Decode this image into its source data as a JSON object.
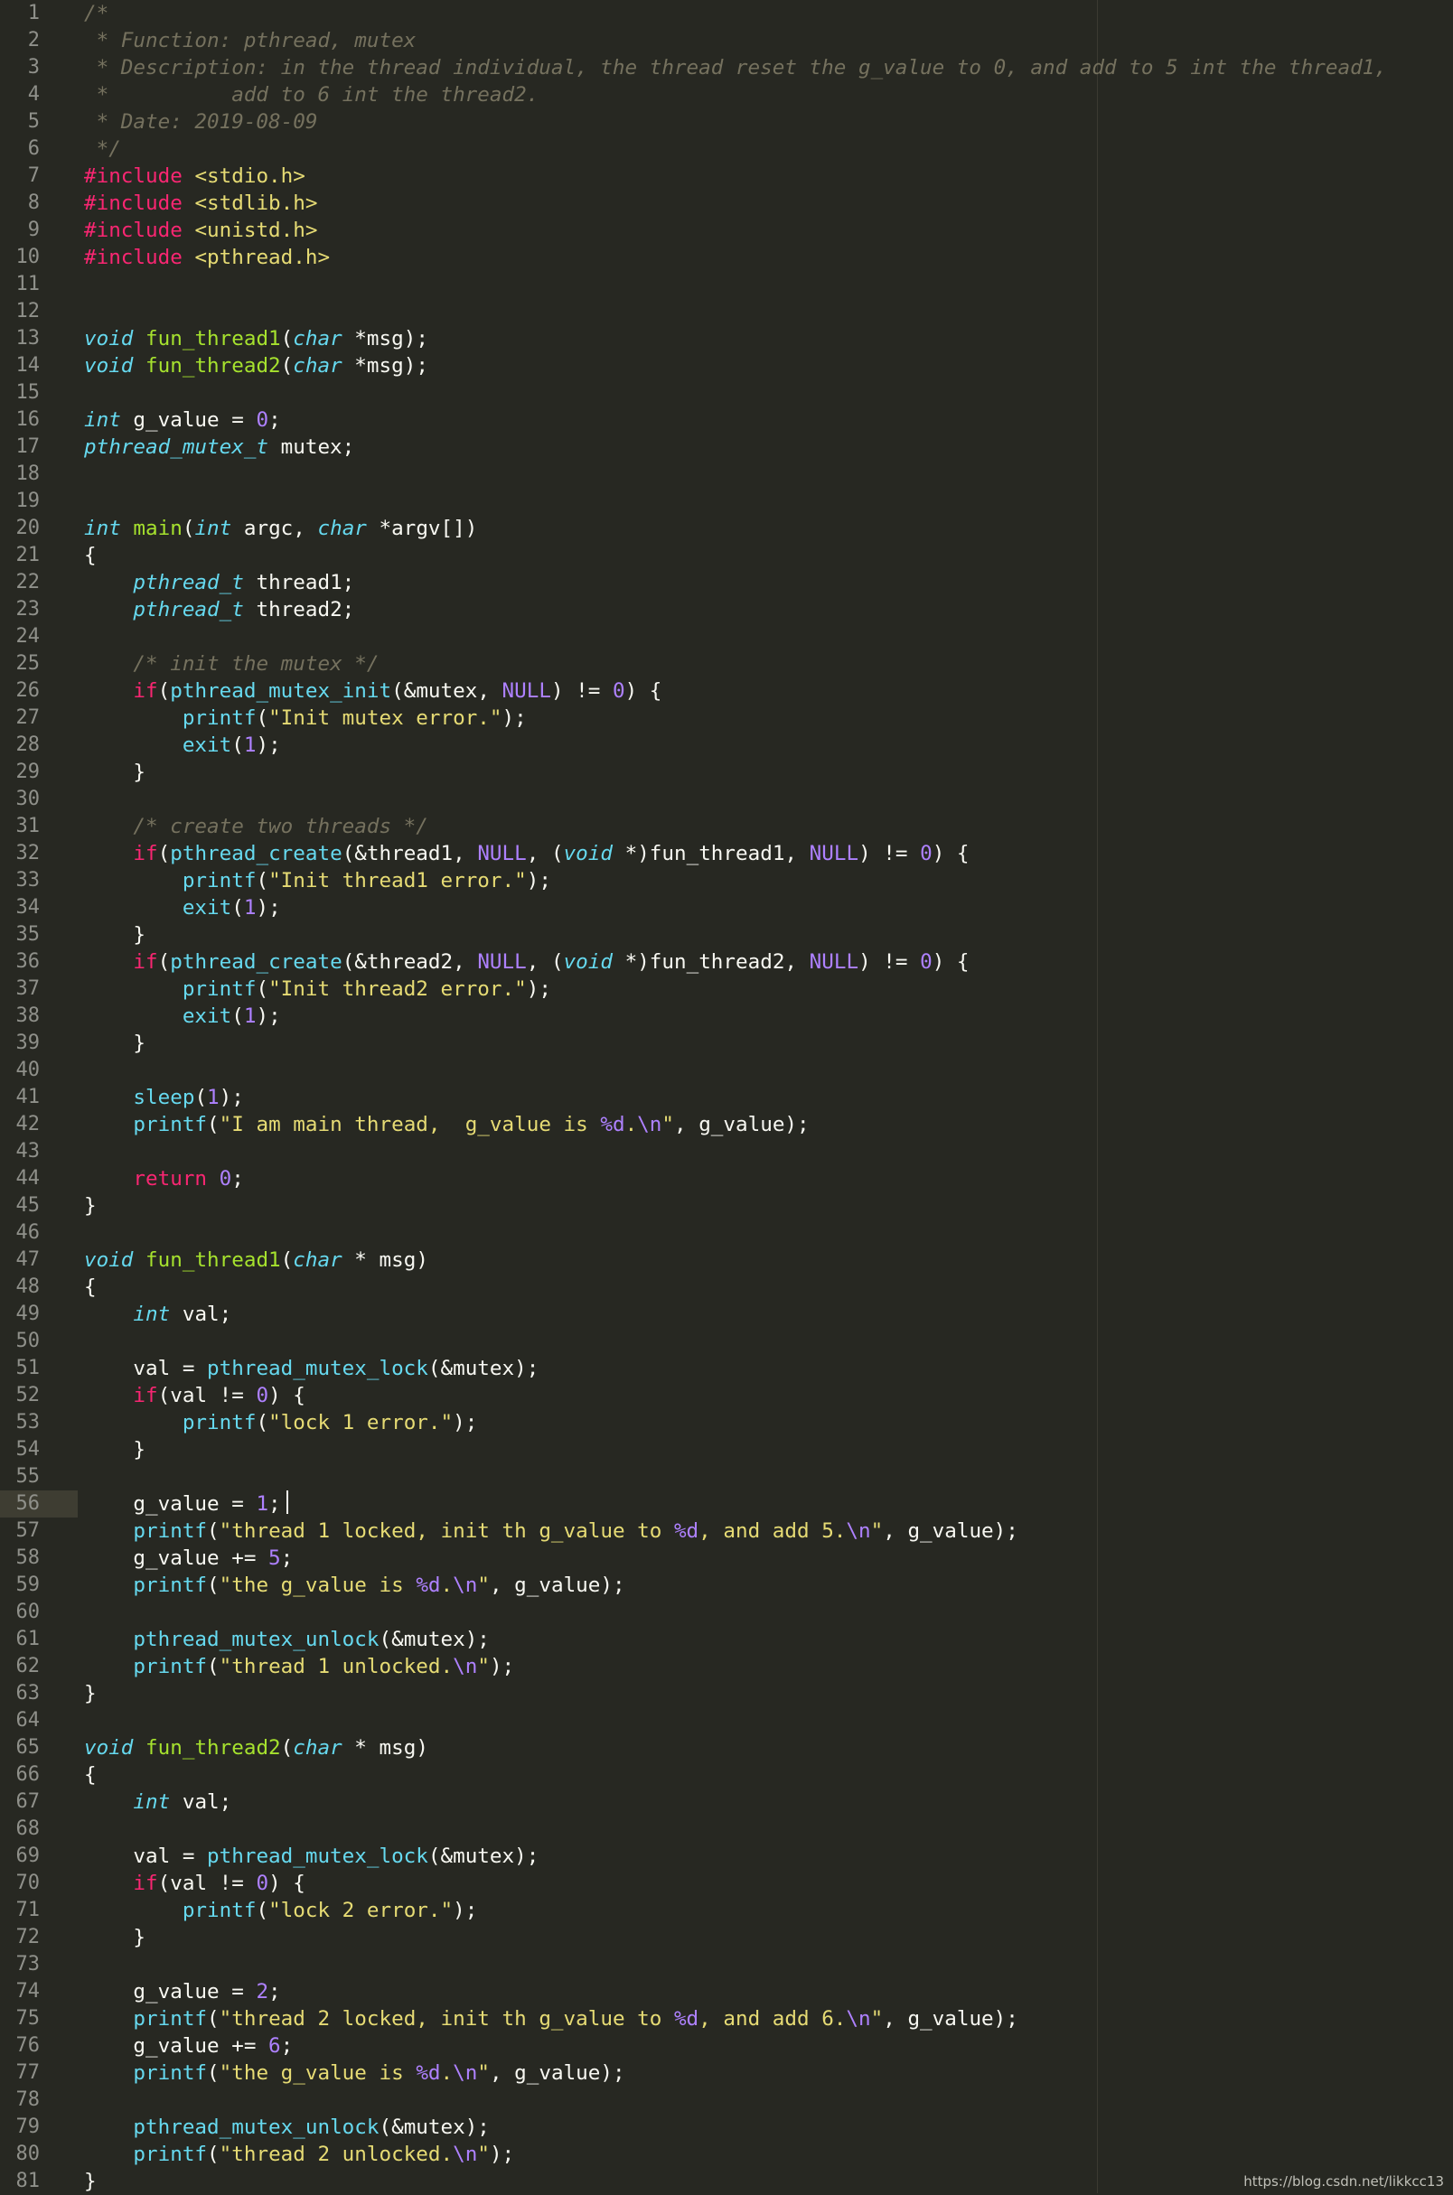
{
  "editor": {
    "colors": {
      "background": "#272822",
      "gutter_text": "#8f908a",
      "current_line": "#3e3d32",
      "ruler": "#3b3a32",
      "default": "#f8f8f2",
      "comment": "#75715e",
      "keyword": "#f92672",
      "type": "#66d9ef",
      "function": "#a6e22e",
      "call": "#66d9ef",
      "string": "#e6db74",
      "number": "#ae81ff"
    },
    "current_line_number": 56,
    "lines": [
      [
        [
          "c",
          "/*"
        ]
      ],
      [
        [
          "c",
          " * Function: pthread, mutex"
        ]
      ],
      [
        [
          "c",
          " * Description: in the thread individual, the thread reset the g_value to 0, and add to 5 int the thread1,"
        ]
      ],
      [
        [
          "c",
          " *          add to 6 int the thread2."
        ]
      ],
      [
        [
          "c",
          " * Date: 2019-08-09"
        ]
      ],
      [
        [
          "c",
          " */"
        ]
      ],
      [
        [
          "k",
          "#include"
        ],
        [
          "n",
          " "
        ],
        [
          "s",
          "<stdio.h>"
        ]
      ],
      [
        [
          "k",
          "#include"
        ],
        [
          "n",
          " "
        ],
        [
          "s",
          "<stdlib.h>"
        ]
      ],
      [
        [
          "k",
          "#include"
        ],
        [
          "n",
          " "
        ],
        [
          "s",
          "<unistd.h>"
        ]
      ],
      [
        [
          "k",
          "#include"
        ],
        [
          "n",
          " "
        ],
        [
          "s",
          "<pthread.h>"
        ]
      ],
      [],
      [],
      [
        [
          "t",
          "void"
        ],
        [
          "n",
          " "
        ],
        [
          "f",
          "fun_thread1"
        ],
        [
          "n",
          "("
        ],
        [
          "t",
          "char"
        ],
        [
          "n",
          " *msg);"
        ]
      ],
      [
        [
          "t",
          "void"
        ],
        [
          "n",
          " "
        ],
        [
          "f",
          "fun_thread2"
        ],
        [
          "n",
          "("
        ],
        [
          "t",
          "char"
        ],
        [
          "n",
          " *msg);"
        ]
      ],
      [],
      [
        [
          "t",
          "int"
        ],
        [
          "n",
          " g_value = "
        ],
        [
          "m",
          "0"
        ],
        [
          "n",
          ";"
        ]
      ],
      [
        [
          "t",
          "pthread_mutex_t"
        ],
        [
          "n",
          " mutex;"
        ]
      ],
      [],
      [],
      [
        [
          "t",
          "int"
        ],
        [
          "n",
          " "
        ],
        [
          "f",
          "main"
        ],
        [
          "n",
          "("
        ],
        [
          "t",
          "int"
        ],
        [
          "n",
          " argc, "
        ],
        [
          "t",
          "char"
        ],
        [
          "n",
          " *argv[])"
        ]
      ],
      [
        [
          "n",
          "{"
        ]
      ],
      [
        [
          "n",
          "    "
        ],
        [
          "t",
          "pthread_t"
        ],
        [
          "n",
          " thread1;"
        ]
      ],
      [
        [
          "n",
          "    "
        ],
        [
          "t",
          "pthread_t"
        ],
        [
          "n",
          " thread2;"
        ]
      ],
      [],
      [
        [
          "n",
          "    "
        ],
        [
          "c",
          "/* init the mutex */"
        ]
      ],
      [
        [
          "n",
          "    "
        ],
        [
          "k",
          "if"
        ],
        [
          "n",
          "("
        ],
        [
          "b",
          "pthread_mutex_init"
        ],
        [
          "n",
          "(&mutex, "
        ],
        [
          "m",
          "NULL"
        ],
        [
          "n",
          ") != "
        ],
        [
          "m",
          "0"
        ],
        [
          "n",
          ") {"
        ]
      ],
      [
        [
          "n",
          "        "
        ],
        [
          "b",
          "printf"
        ],
        [
          "n",
          "("
        ],
        [
          "s",
          "\"Init mutex error.\""
        ],
        [
          "n",
          ");"
        ]
      ],
      [
        [
          "n",
          "        "
        ],
        [
          "b",
          "exit"
        ],
        [
          "n",
          "("
        ],
        [
          "m",
          "1"
        ],
        [
          "n",
          ");"
        ]
      ],
      [
        [
          "n",
          "    }"
        ]
      ],
      [],
      [
        [
          "n",
          "    "
        ],
        [
          "c",
          "/* create two threads */"
        ]
      ],
      [
        [
          "n",
          "    "
        ],
        [
          "k",
          "if"
        ],
        [
          "n",
          "("
        ],
        [
          "b",
          "pthread_create"
        ],
        [
          "n",
          "(&thread1, "
        ],
        [
          "m",
          "NULL"
        ],
        [
          "n",
          ", ("
        ],
        [
          "t",
          "void"
        ],
        [
          "n",
          " *)fun_thread1, "
        ],
        [
          "m",
          "NULL"
        ],
        [
          "n",
          ") != "
        ],
        [
          "m",
          "0"
        ],
        [
          "n",
          ") {"
        ]
      ],
      [
        [
          "n",
          "        "
        ],
        [
          "b",
          "printf"
        ],
        [
          "n",
          "("
        ],
        [
          "s",
          "\"Init thread1 error.\""
        ],
        [
          "n",
          ");"
        ]
      ],
      [
        [
          "n",
          "        "
        ],
        [
          "b",
          "exit"
        ],
        [
          "n",
          "("
        ],
        [
          "m",
          "1"
        ],
        [
          "n",
          ");"
        ]
      ],
      [
        [
          "n",
          "    }"
        ]
      ],
      [
        [
          "n",
          "    "
        ],
        [
          "k",
          "if"
        ],
        [
          "n",
          "("
        ],
        [
          "b",
          "pthread_create"
        ],
        [
          "n",
          "(&thread2, "
        ],
        [
          "m",
          "NULL"
        ],
        [
          "n",
          ", ("
        ],
        [
          "t",
          "void"
        ],
        [
          "n",
          " *)fun_thread2, "
        ],
        [
          "m",
          "NULL"
        ],
        [
          "n",
          ") != "
        ],
        [
          "m",
          "0"
        ],
        [
          "n",
          ") {"
        ]
      ],
      [
        [
          "n",
          "        "
        ],
        [
          "b",
          "printf"
        ],
        [
          "n",
          "("
        ],
        [
          "s",
          "\"Init thread2 error.\""
        ],
        [
          "n",
          ");"
        ]
      ],
      [
        [
          "n",
          "        "
        ],
        [
          "b",
          "exit"
        ],
        [
          "n",
          "("
        ],
        [
          "m",
          "1"
        ],
        [
          "n",
          ");"
        ]
      ],
      [
        [
          "n",
          "    }"
        ]
      ],
      [],
      [
        [
          "n",
          "    "
        ],
        [
          "b",
          "sleep"
        ],
        [
          "n",
          "("
        ],
        [
          "m",
          "1"
        ],
        [
          "n",
          ");"
        ]
      ],
      [
        [
          "n",
          "    "
        ],
        [
          "b",
          "printf"
        ],
        [
          "n",
          "("
        ],
        [
          "s",
          "\"I am main thread,  g_value is "
        ],
        [
          "m",
          "%d"
        ],
        [
          "s",
          "."
        ],
        [
          "m",
          "\\n"
        ],
        [
          "s",
          "\""
        ],
        [
          "n",
          ", g_value);"
        ]
      ],
      [],
      [
        [
          "n",
          "    "
        ],
        [
          "k",
          "return"
        ],
        [
          "n",
          " "
        ],
        [
          "m",
          "0"
        ],
        [
          "n",
          ";"
        ]
      ],
      [
        [
          "n",
          "}"
        ]
      ],
      [],
      [
        [
          "t",
          "void"
        ],
        [
          "n",
          " "
        ],
        [
          "f",
          "fun_thread1"
        ],
        [
          "n",
          "("
        ],
        [
          "t",
          "char"
        ],
        [
          "n",
          " * msg)"
        ]
      ],
      [
        [
          "n",
          "{"
        ]
      ],
      [
        [
          "n",
          "    "
        ],
        [
          "t",
          "int"
        ],
        [
          "n",
          " val;"
        ]
      ],
      [],
      [
        [
          "n",
          "    val = "
        ],
        [
          "b",
          "pthread_mutex_lock"
        ],
        [
          "n",
          "(&mutex);"
        ]
      ],
      [
        [
          "n",
          "    "
        ],
        [
          "k",
          "if"
        ],
        [
          "n",
          "(val != "
        ],
        [
          "m",
          "0"
        ],
        [
          "n",
          ") {"
        ]
      ],
      [
        [
          "n",
          "        "
        ],
        [
          "b",
          "printf"
        ],
        [
          "n",
          "("
        ],
        [
          "s",
          "\"lock 1 error.\""
        ],
        [
          "n",
          ");"
        ]
      ],
      [
        [
          "n",
          "    }"
        ]
      ],
      [],
      [
        [
          "n",
          "    g_value = "
        ],
        [
          "m",
          "1"
        ],
        [
          "n",
          ";"
        ]
      ],
      [
        [
          "n",
          "    "
        ],
        [
          "b",
          "printf"
        ],
        [
          "n",
          "("
        ],
        [
          "s",
          "\"thread 1 locked, init th g_value to "
        ],
        [
          "m",
          "%d"
        ],
        [
          "s",
          ", and add 5."
        ],
        [
          "m",
          "\\n"
        ],
        [
          "s",
          "\""
        ],
        [
          "n",
          ", g_value);"
        ]
      ],
      [
        [
          "n",
          "    g_value += "
        ],
        [
          "m",
          "5"
        ],
        [
          "n",
          ";"
        ]
      ],
      [
        [
          "n",
          "    "
        ],
        [
          "b",
          "printf"
        ],
        [
          "n",
          "("
        ],
        [
          "s",
          "\"the g_value is "
        ],
        [
          "m",
          "%d"
        ],
        [
          "s",
          "."
        ],
        [
          "m",
          "\\n"
        ],
        [
          "s",
          "\""
        ],
        [
          "n",
          ", g_value);"
        ]
      ],
      [],
      [
        [
          "n",
          "    "
        ],
        [
          "b",
          "pthread_mutex_unlock"
        ],
        [
          "n",
          "(&mutex);"
        ]
      ],
      [
        [
          "n",
          "    "
        ],
        [
          "b",
          "printf"
        ],
        [
          "n",
          "("
        ],
        [
          "s",
          "\"thread 1 unlocked."
        ],
        [
          "m",
          "\\n"
        ],
        [
          "s",
          "\""
        ],
        [
          "n",
          ");"
        ]
      ],
      [
        [
          "n",
          "}"
        ]
      ],
      [],
      [
        [
          "t",
          "void"
        ],
        [
          "n",
          " "
        ],
        [
          "f",
          "fun_thread2"
        ],
        [
          "n",
          "("
        ],
        [
          "t",
          "char"
        ],
        [
          "n",
          " * msg)"
        ]
      ],
      [
        [
          "n",
          "{"
        ]
      ],
      [
        [
          "n",
          "    "
        ],
        [
          "t",
          "int"
        ],
        [
          "n",
          " val;"
        ]
      ],
      [],
      [
        [
          "n",
          "    val = "
        ],
        [
          "b",
          "pthread_mutex_lock"
        ],
        [
          "n",
          "(&mutex);"
        ]
      ],
      [
        [
          "n",
          "    "
        ],
        [
          "k",
          "if"
        ],
        [
          "n",
          "(val != "
        ],
        [
          "m",
          "0"
        ],
        [
          "n",
          ") {"
        ]
      ],
      [
        [
          "n",
          "        "
        ],
        [
          "b",
          "printf"
        ],
        [
          "n",
          "("
        ],
        [
          "s",
          "\"lock 2 error.\""
        ],
        [
          "n",
          ");"
        ]
      ],
      [
        [
          "n",
          "    }"
        ]
      ],
      [],
      [
        [
          "n",
          "    g_value = "
        ],
        [
          "m",
          "2"
        ],
        [
          "n",
          ";"
        ]
      ],
      [
        [
          "n",
          "    "
        ],
        [
          "b",
          "printf"
        ],
        [
          "n",
          "("
        ],
        [
          "s",
          "\"thread 2 locked, init th g_value to "
        ],
        [
          "m",
          "%d"
        ],
        [
          "s",
          ", and add 6."
        ],
        [
          "m",
          "\\n"
        ],
        [
          "s",
          "\""
        ],
        [
          "n",
          ", g_value);"
        ]
      ],
      [
        [
          "n",
          "    g_value += "
        ],
        [
          "m",
          "6"
        ],
        [
          "n",
          ";"
        ]
      ],
      [
        [
          "n",
          "    "
        ],
        [
          "b",
          "printf"
        ],
        [
          "n",
          "("
        ],
        [
          "s",
          "\"the g_value is "
        ],
        [
          "m",
          "%d"
        ],
        [
          "s",
          "."
        ],
        [
          "m",
          "\\n"
        ],
        [
          "s",
          "\""
        ],
        [
          "n",
          ", g_value);"
        ]
      ],
      [],
      [
        [
          "n",
          "    "
        ],
        [
          "b",
          "pthread_mutex_unlock"
        ],
        [
          "n",
          "(&mutex);"
        ]
      ],
      [
        [
          "n",
          "    "
        ],
        [
          "b",
          "printf"
        ],
        [
          "n",
          "("
        ],
        [
          "s",
          "\"thread 2 unlocked."
        ],
        [
          "m",
          "\\n"
        ],
        [
          "s",
          "\""
        ],
        [
          "n",
          ");"
        ]
      ],
      [
        [
          "n",
          "}"
        ]
      ]
    ]
  },
  "watermark": "https://blog.csdn.net/likkcc13"
}
